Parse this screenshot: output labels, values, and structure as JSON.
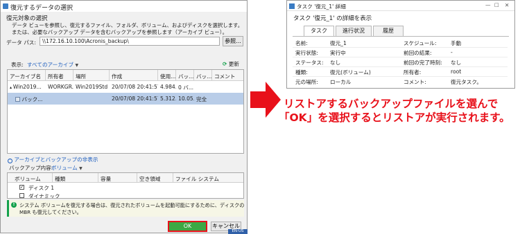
{
  "dialog": {
    "title": "復元するデータの選択",
    "section_title": "復元対象の選択",
    "description": "データ ビューを参照し、復元するファイル、フォルダ、ボリューム、およびディスクを選択します。または、必要なバックアップ データを含むバックアップを参照します（アーカイブ ビュー）。",
    "path_label": "データ パス:",
    "path_value": "\\\\172.16.10.100\\Acronis_backup\\",
    "browse_label": "参照...",
    "show_label": "表示:",
    "show_value": "すべてのアーカイブ",
    "refresh_label": "更新",
    "archive_columns": [
      "アーカイブ名",
      "所有者",
      "場所",
      "作成",
      "使用...",
      "バッ...",
      "バッ...",
      "コメント"
    ],
    "archive_rows": [
      {
        "name": "Win2019...",
        "owner": "WORKGR...",
        "location": "Win2019Std",
        "created": "20/07/08 20:41:57",
        "used": "4.984...",
        "b1": "0 バ...",
        "b2": "",
        "comment": ""
      },
      {
        "name": "バック...",
        "owner": "",
        "location": "",
        "created": "20/07/08 20:41:57",
        "used": "5.312...",
        "b1": "10.05...",
        "b2": "完全",
        "comment": ""
      }
    ],
    "hide_link": "アーカイブとバックアップの非表示",
    "backup_content_label": "バックアップ内容:",
    "backup_content_value": "ボリューム",
    "volume_columns": [
      "ボリューム",
      "種類",
      "容量",
      "空き領域",
      "ファイル システム"
    ],
    "volume_rows": [
      "ディスク 1",
      "ダイナミック"
    ],
    "info_text_1": "システム ボリュームを復元する場合は、復元されたボリュームを起動可能にするために、ディスクの",
    "info_text_2": "MBR も復元してください。",
    "ok_label": "OK",
    "cancel_label": "キャンセル",
    "lang_indicator": "EN-US"
  },
  "task_window": {
    "title": "タスク '復元_1' 詳細",
    "heading": "タスク '復元_1' の詳細を表示",
    "tabs": [
      "タスク",
      "進行状況",
      "履歴"
    ],
    "fields": [
      {
        "label": "名前:",
        "value": "復元_1",
        "label2": "スケジュール:",
        "value2": "手動"
      },
      {
        "label": "実行状態:",
        "value": "実行中",
        "label2": "前回の結果:",
        "value2": "-"
      },
      {
        "label": "ステータス:",
        "value": "なし",
        "label2": "前回の完了時刻:",
        "value2": "なし"
      },
      {
        "label": "種類:",
        "value": "復元(ボリューム)",
        "label2": "所有者:",
        "value2": "root"
      },
      {
        "label": "元の場所:",
        "value": "ローカル",
        "label2": "コメント:",
        "value2": "復元タスク。"
      }
    ]
  },
  "annotation": {
    "line1": "リストアするバックアップファイルを選んで",
    "line2": "「OK」を選択するとリストアが実行されます。"
  },
  "colors": {
    "highlight_green": "#14a14c",
    "ok_border_red": "#e8101a",
    "arrow_red": "#e8101a",
    "row_selected": "#b9cde8",
    "info_bg": "#f6f6e6"
  }
}
